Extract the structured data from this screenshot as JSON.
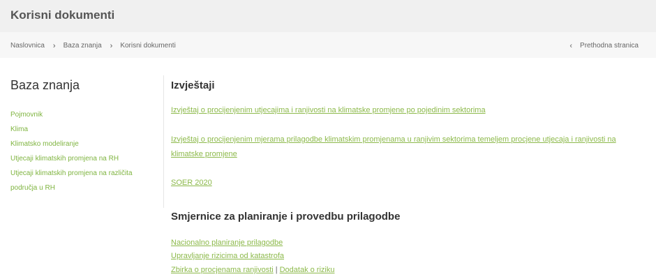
{
  "header": {
    "title": "Korisni dokumenti"
  },
  "breadcrumb": {
    "items": [
      "Naslovnica",
      "Baza znanja",
      "Korisni dokumenti"
    ],
    "separator": "›",
    "back_icon": "‹",
    "back_label": "Prethodna stranica"
  },
  "sidebar": {
    "title": "Baza znanja",
    "items": [
      "Pojmovnik",
      "Klima",
      "Klimatsko modeliranje",
      "Utjecaji klimatskih promjena na RH",
      "Utjecaji klimatskih promjena na različita",
      "područja u RH"
    ]
  },
  "main": {
    "sections": [
      {
        "title": "Izvještaji",
        "links": [
          "Izvještaj o procijenjenim utjecajima i ranjivosti na klimatske promjene po pojedinim sektorima",
          "Izvještaj o procijenjenim mjerama prilagodbe klimatskim promjenama u ranjivim sektorima temeljem procjene utjecaja i ranjivosti na klimatske promjene",
          "SOER 2020"
        ]
      },
      {
        "title": "Smjernice za planiranje i provedbu prilagodbe",
        "links": [
          "Nacionalno planiranje prilagodbe",
          "Upravljanje rizicima od katastrofa",
          "Zbirka o procjenama ranjivosti",
          "Dodatak o riziku"
        ],
        "pipe": "|"
      }
    ]
  },
  "colors": {
    "link": "#8cb94a",
    "header_bg": "#f0f0f0",
    "crumb_bg": "#f7f7f7"
  }
}
